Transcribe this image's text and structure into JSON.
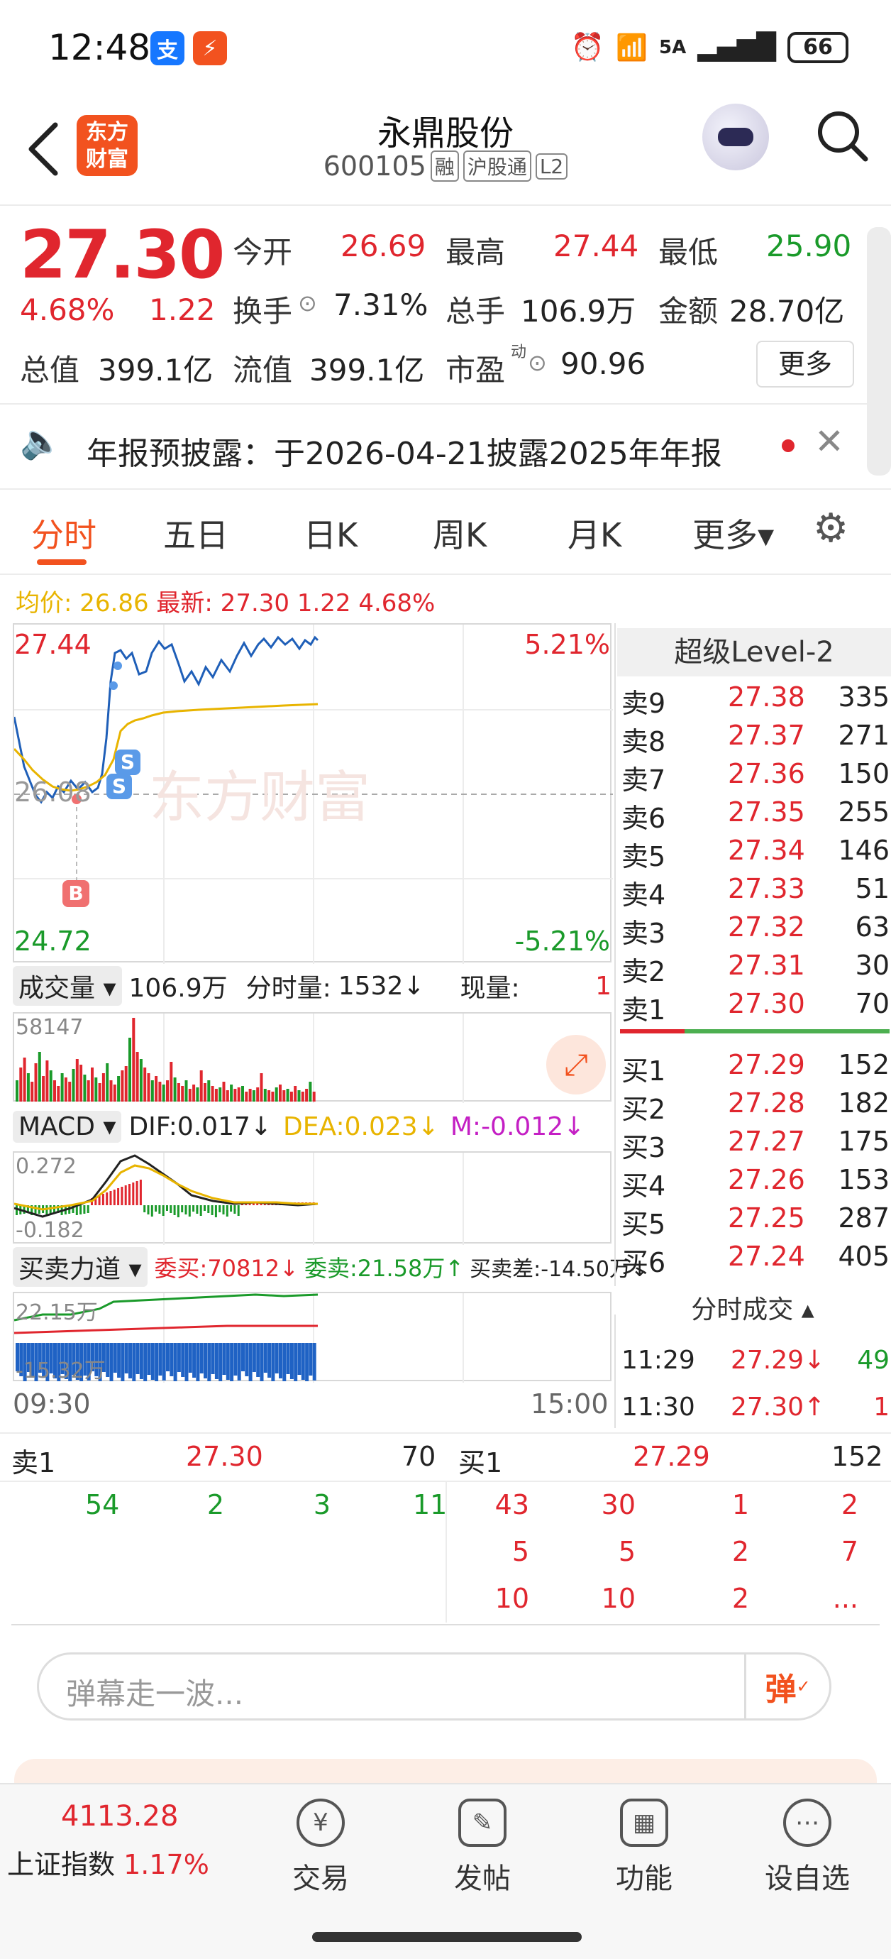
{
  "status_bar": {
    "time": "12:48",
    "battery": "66",
    "network": "5A"
  },
  "header": {
    "stock_name": "永鼎股份",
    "stock_code": "600105",
    "tags": [
      "融",
      "沪股通",
      "L2"
    ],
    "logo_text": "东方财富"
  },
  "quote": {
    "price": "27.30",
    "change_pct": "4.68%",
    "change": "1.22",
    "open_label": "今开",
    "open": "26.69",
    "high_label": "最高",
    "high": "27.44",
    "low_label": "最低",
    "low": "25.90",
    "turnover_label": "换手",
    "turnover": "7.31%",
    "volume_label": "总手",
    "volume": "106.9万",
    "amount_label": "金额",
    "amount": "28.70亿",
    "mktcap_label": "总值",
    "mktcap": "399.1亿",
    "float_label": "流值",
    "float_cap": "399.1亿",
    "pe_label": "市盈",
    "pe_sup": "动",
    "pe": "90.96",
    "more_label": "更多"
  },
  "notice": {
    "text": "年报预披露：于2026-04-21披露2025年年报"
  },
  "tabs": [
    "分时",
    "五日",
    "日K",
    "周K",
    "月K",
    "更多▾"
  ],
  "intraday": {
    "avg_label": "均价: 26.86",
    "latest_label": "最新: 27.30 1.22 4.68%",
    "top_price": "27.44",
    "top_pct": "5.21%",
    "bottom_price": "24.72",
    "bottom_pct": "-5.21%",
    "mid_price": "26.08",
    "watermark": "东方财富",
    "marker_s": "S",
    "marker_b": "B",
    "time_start": "09:30",
    "time_end": "15:00"
  },
  "volume_bar": {
    "selector": "成交量",
    "total": "106.9万",
    "min_label": "分时量:",
    "min_value": "1532↓",
    "now_label": "现量:",
    "now_value": "1",
    "max_label": "58147"
  },
  "macd": {
    "selector": "MACD",
    "dif": "DIF:0.017↓",
    "dea": "DEA:0.023↓",
    "m": "M:-0.012↓",
    "max_label": "0.272",
    "min_label": "-0.182"
  },
  "force": {
    "selector": "买卖力道",
    "buy": "委买:70812↓",
    "sell": "委卖:21.58万↑",
    "diff": "买卖差:-14.50万↓",
    "max_label": "22.15万",
    "min_label": "-15.32万"
  },
  "order_book": {
    "title": "超级Level-2",
    "asks": [
      {
        "label": "卖9",
        "price": "27.38",
        "vol": "335"
      },
      {
        "label": "卖8",
        "price": "27.37",
        "vol": "271"
      },
      {
        "label": "卖7",
        "price": "27.36",
        "vol": "150"
      },
      {
        "label": "卖6",
        "price": "27.35",
        "vol": "255"
      },
      {
        "label": "卖5",
        "price": "27.34",
        "vol": "146"
      },
      {
        "label": "卖4",
        "price": "27.33",
        "vol": "51"
      },
      {
        "label": "卖3",
        "price": "27.32",
        "vol": "63"
      },
      {
        "label": "卖2",
        "price": "27.31",
        "vol": "30"
      },
      {
        "label": "卖1",
        "price": "27.30",
        "vol": "70"
      }
    ],
    "bids": [
      {
        "label": "买1",
        "price": "27.29",
        "vol": "152"
      },
      {
        "label": "买2",
        "price": "27.28",
        "vol": "182"
      },
      {
        "label": "买3",
        "price": "27.27",
        "vol": "175"
      },
      {
        "label": "买4",
        "price": "27.26",
        "vol": "153"
      },
      {
        "label": "买5",
        "price": "27.25",
        "vol": "287"
      },
      {
        "label": "买6",
        "price": "27.24",
        "vol": "405"
      }
    ],
    "ticks_title": "分时成交 ▴",
    "ticks": [
      {
        "time": "11:29",
        "price": "27.29↓",
        "vol": "49"
      },
      {
        "time": "11:30",
        "price": "27.30↑",
        "vol": "1"
      }
    ]
  },
  "level1": {
    "sell_label": "卖1",
    "sell_price": "27.30",
    "sell_vol": "70",
    "buy_label": "买1",
    "buy_price": "27.29",
    "buy_vol": "152",
    "sell_queue": [
      "54",
      "2",
      "3",
      "11"
    ],
    "buy_queue": [
      [
        "43",
        "30",
        "1",
        "2"
      ],
      [
        "5",
        "5",
        "2",
        "7"
      ],
      [
        "10",
        "10",
        "2",
        "..."
      ]
    ]
  },
  "danmu": {
    "placeholder": "弹幕走一波...",
    "button": "弹"
  },
  "bottom_nav": {
    "index_value": "4113.28",
    "index_name": "上证指数",
    "index_pct": "1.17%",
    "items": [
      "交易",
      "发帖",
      "功能",
      "设自选"
    ]
  },
  "colors": {
    "up": "#e0262e",
    "down": "#1a9a2a",
    "brand": "#f2521f",
    "avg": "#e8b400"
  }
}
